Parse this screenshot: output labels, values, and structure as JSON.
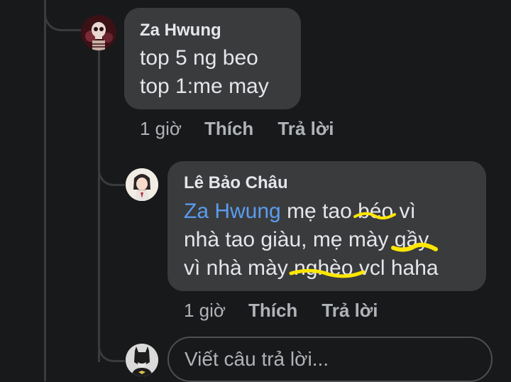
{
  "comments": [
    {
      "author": "Za Hwung",
      "lines": [
        "top 5 ng beo",
        "top 1:me may"
      ],
      "time": "1 giờ",
      "like_label": "Thích",
      "reply_label": "Trả lời"
    },
    {
      "author": "Lê Bảo Châu",
      "mention": "Za Hwung",
      "segments": {
        "s1": " mẹ tao ",
        "w1": "béo",
        "s2": " vì",
        "s3": "nhà tao giàu, mẹ mày ",
        "w2": "gầy",
        "s4": "vì nhà mày ",
        "w3": "nghèo",
        "s5": " vcl haha"
      },
      "time": "1 giờ",
      "like_label": "Thích",
      "reply_label": "Trả lời"
    }
  ],
  "reply_box": {
    "placeholder": "Viết câu trả lời..."
  },
  "colors": {
    "background": "#18191a",
    "bubble": "#3a3b3c",
    "text": "#e4e6eb",
    "muted": "#b0b3b8",
    "mention": "#5a9cf0",
    "highlight_scribble": "#ffe600"
  },
  "icons": [
    "skull-avatar-icon",
    "anime-avatar-icon",
    "batman-avatar-icon"
  ]
}
